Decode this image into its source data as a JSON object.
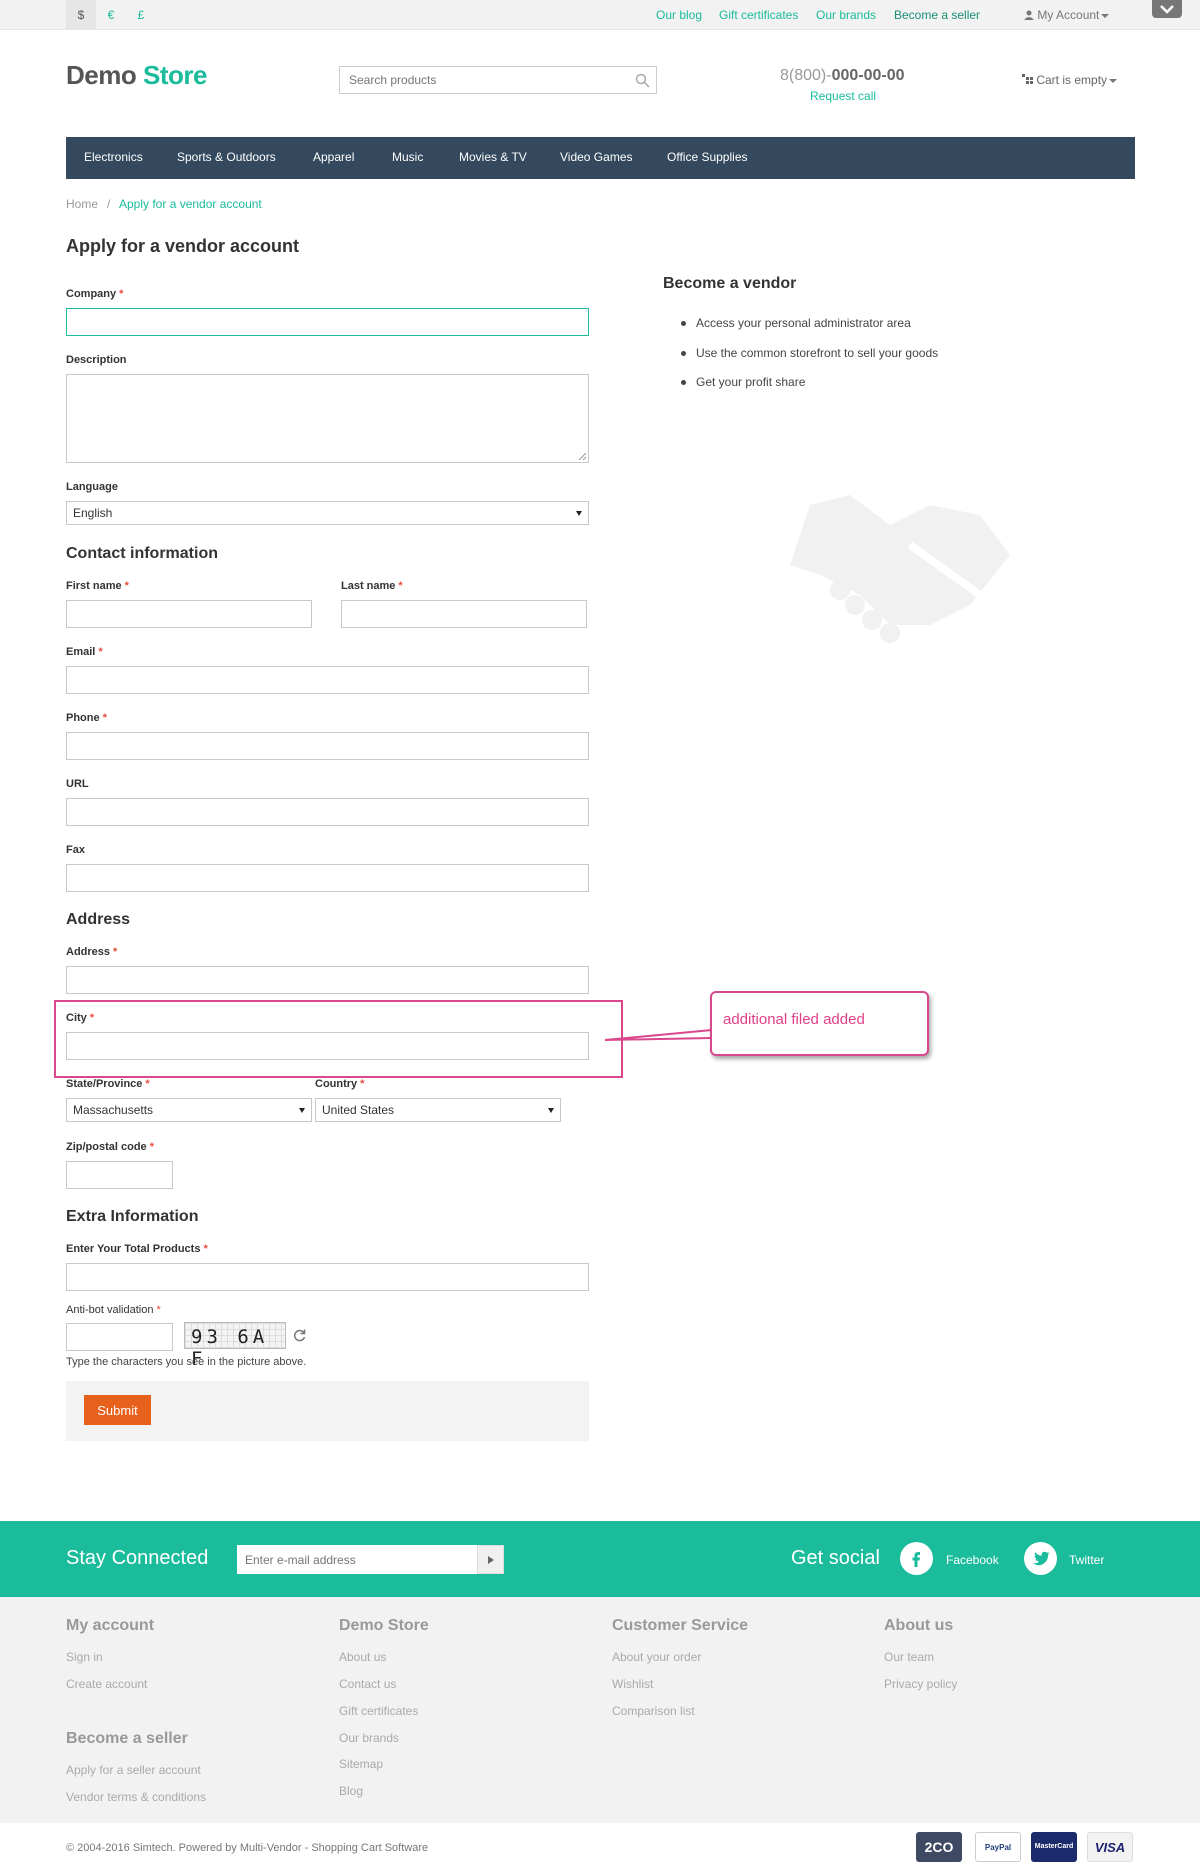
{
  "topbar": {
    "currencies": [
      "$",
      "€",
      "£"
    ],
    "links": [
      "Our blog",
      "Gift certificates",
      "Our brands",
      "Become a seller"
    ],
    "my_account": "My Account"
  },
  "header": {
    "logo_part1": "Demo",
    "logo_part2": "Store",
    "search_placeholder": "Search products",
    "phone_prefix": "8(800)-",
    "phone_number": "000-00-00",
    "request_call": "Request call",
    "cart": "Cart is empty"
  },
  "nav": [
    "Electronics",
    "Sports & Outdoors",
    "Apparel",
    "Music",
    "Movies & TV",
    "Video Games",
    "Office Supplies"
  ],
  "breadcrumb": {
    "home": "Home",
    "separator": "/",
    "current": "Apply for a vendor account"
  },
  "form": {
    "title": "Apply for a vendor account",
    "company_label": "Company",
    "description_label": "Description",
    "language_label": "Language",
    "language_value": "English",
    "contact_heading": "Contact information",
    "first_name_label": "First name",
    "last_name_label": "Last name",
    "email_label": "Email",
    "phone_label": "Phone",
    "url_label": "URL",
    "fax_label": "Fax",
    "address_heading": "Address",
    "address_label": "Address",
    "city_label": "City",
    "state_label": "State/Province",
    "state_value": "Massachusetts",
    "country_label": "Country",
    "country_value": "United States",
    "zip_label": "Zip/postal code",
    "extra_heading": "Extra Information",
    "total_products_label": "Enter Your Total Products",
    "antibot_label": "Anti-bot validation",
    "captcha_text": "93 6A F",
    "captcha_hint": "Type the characters you see in the picture above.",
    "submit": "Submit",
    "required_mark": "*"
  },
  "sidebar": {
    "title": "Become a vendor",
    "items": [
      "Access your personal administrator area",
      "Use the common storefront to sell your goods",
      "Get your profit share"
    ]
  },
  "annotation": {
    "text": "additional filed added"
  },
  "subscribe": {
    "title": "Stay Connected",
    "email_placeholder": "Enter e-mail address",
    "social_title": "Get social",
    "facebook": "Facebook",
    "twitter": "Twitter"
  },
  "footer": {
    "columns": [
      {
        "title": "My account",
        "links": [
          "Sign in",
          "Create account"
        ]
      },
      {
        "title": "Demo Store",
        "links": [
          "About us",
          "Contact us",
          "Gift certificates",
          "Our brands",
          "Sitemap",
          "Blog"
        ]
      },
      {
        "title": "Customer Service",
        "links": [
          "About your order",
          "Wishlist",
          "Comparison list"
        ]
      },
      {
        "title": "About us",
        "links": [
          "Our team",
          "Privacy policy"
        ]
      }
    ],
    "seller": {
      "title": "Become a seller",
      "links": [
        "Apply for a seller account",
        "Vendor terms & conditions"
      ]
    },
    "copyright": "© 2004-2016 Simtech.  Powered by Multi-Vendor - Shopping Cart Software",
    "payments": [
      "2CO",
      "PayPal",
      "MasterCard",
      "VISA"
    ]
  },
  "colors": {
    "accent": "#1abc9c",
    "nav": "#34495e",
    "submit": "#e8611c",
    "annotation": "#d9478d"
  }
}
